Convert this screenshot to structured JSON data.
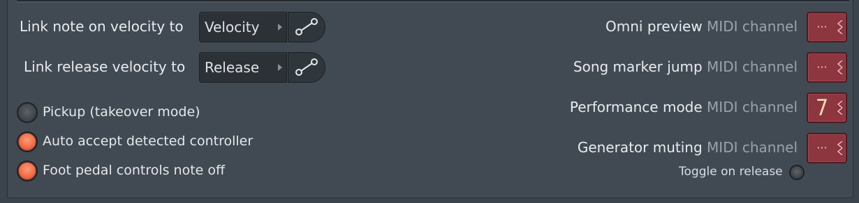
{
  "links": [
    {
      "label": "Link note on velocity to",
      "value": "Velocity"
    },
    {
      "label": "Link release velocity to",
      "value": "Release"
    }
  ],
  "options": [
    {
      "label": "Pickup (takeover mode)",
      "checked": false
    },
    {
      "label": "Auto accept detected controller",
      "checked": true
    },
    {
      "label": "Foot pedal controls note off",
      "checked": true
    }
  ],
  "midi_rows": [
    {
      "name": "Omni preview",
      "suffix": "MIDI channel",
      "value": "···"
    },
    {
      "name": "Song marker jump",
      "suffix": "MIDI channel",
      "value": "···"
    },
    {
      "name": "Performance mode",
      "suffix": "MIDI channel",
      "value": "7"
    },
    {
      "name": "Generator muting",
      "suffix": "MIDI channel",
      "value": "···"
    }
  ],
  "toggle": {
    "label": "Toggle on release",
    "checked": false
  },
  "colors": {
    "accent_on": "#f06a45",
    "midi_box": "#8e3640"
  }
}
